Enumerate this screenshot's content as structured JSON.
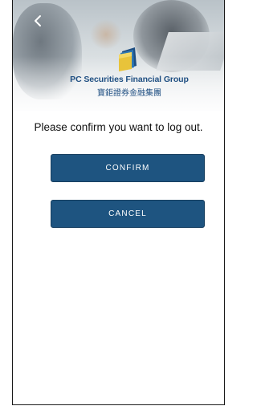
{
  "header": {
    "back_icon": "chevron-left-icon",
    "brand_name_en": "PC Securities Financial Group",
    "brand_name_zh": "寶鉅證券金融集團",
    "logo_icon": "document-stack-logo",
    "brand_color": "#1f4f82"
  },
  "dialog": {
    "message": "Please confirm you want to log out.",
    "confirm_label": "CONFIRM",
    "cancel_label": "CANCEL",
    "button_color": "#1e5480"
  }
}
